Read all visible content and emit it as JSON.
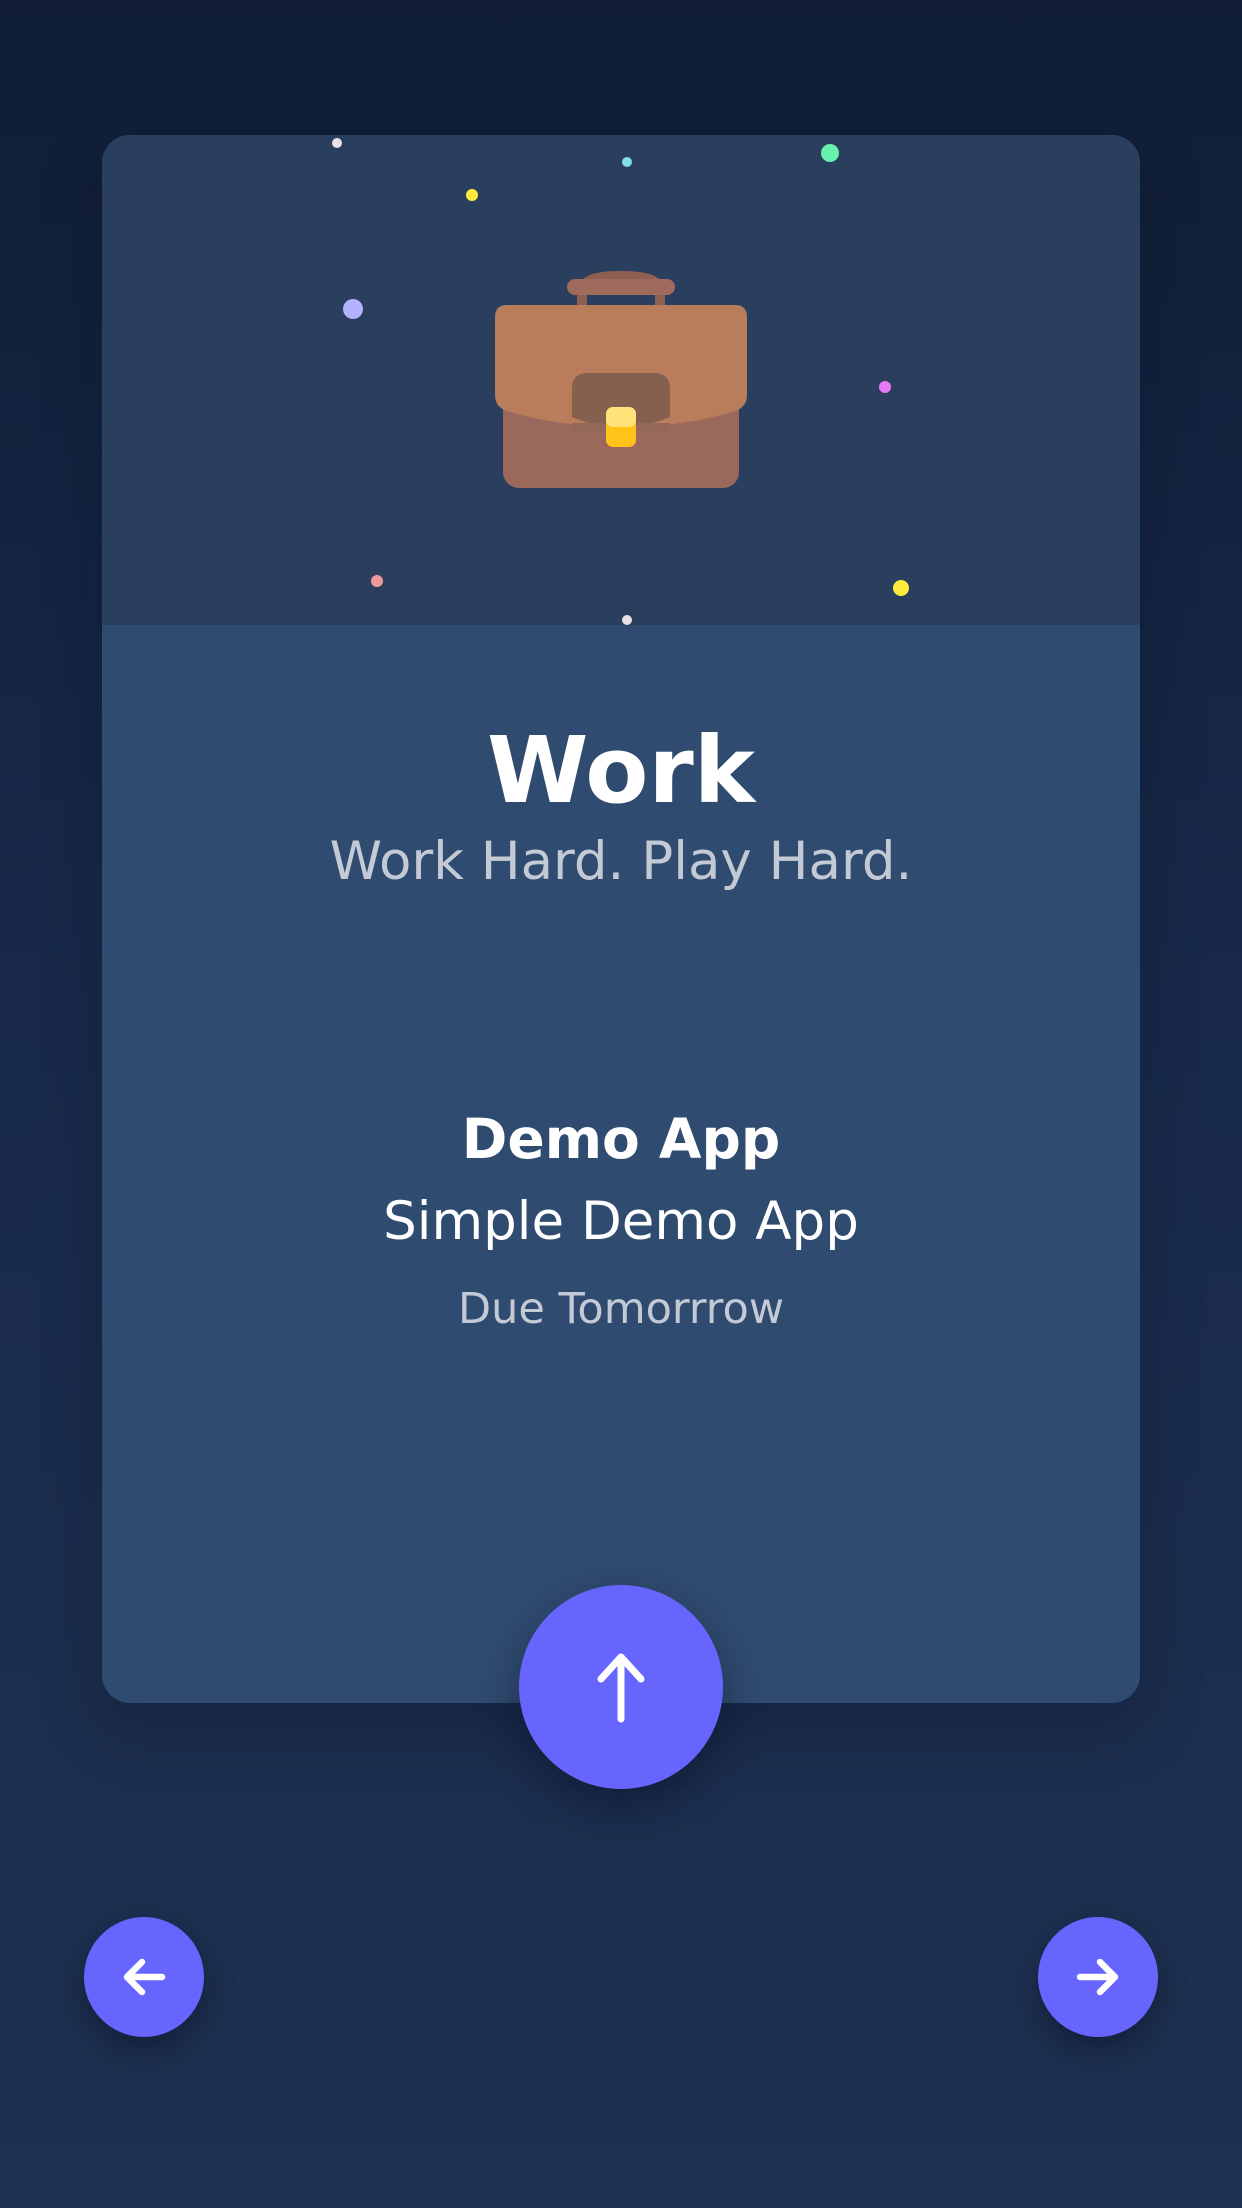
{
  "category": {
    "title": "Work",
    "subtitle": "Work Hard. Play Hard.",
    "icon": "briefcase-icon"
  },
  "task": {
    "name": "Demo App",
    "description": "Simple Demo App",
    "due": "Due Tomorrrow"
  },
  "actions": {
    "expand_icon": "arrow-up-icon",
    "previous_icon": "arrow-left-icon",
    "next_icon": "arrow-right-icon"
  },
  "colors": {
    "background": "#14233f",
    "card": "#2f4b6f",
    "card_header": "#2a3f5e",
    "accent": "#6666ff",
    "text_primary": "#ffffff",
    "text_secondary": "#c3cad6",
    "confetti": [
      "#e8e2e6",
      "#ffeb3b",
      "#80deea",
      "#69f0ae",
      "#b3b3ff",
      "#e879f9",
      "#ef9a9a"
    ]
  }
}
